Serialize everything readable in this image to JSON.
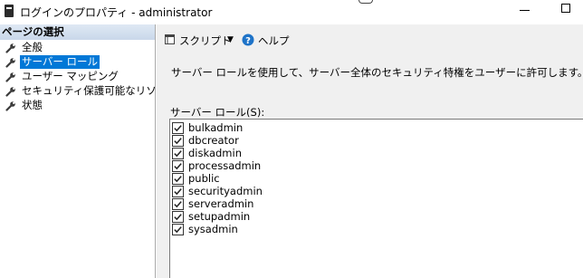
{
  "window": {
    "title": "ログインのプロパティ - administrator"
  },
  "left_pane": {
    "header": "ページの選択",
    "items": [
      {
        "label": "全般",
        "selected": false
      },
      {
        "label": "サーバー ロール",
        "selected": true
      },
      {
        "label": "ユーザー マッピング",
        "selected": false
      },
      {
        "label": "セキュリティ保護可能なリソース",
        "selected": false
      },
      {
        "label": "状態",
        "selected": false
      }
    ]
  },
  "toolbar": {
    "script_label": "スクリプト",
    "help_label": "ヘルプ"
  },
  "main": {
    "description": "サーバー ロールを使用して、サーバー全体のセキュリティ特権をユーザーに許可します。",
    "roles_label": "サーバー ロール(S):",
    "roles": [
      {
        "name": "bulkadmin",
        "checked": true
      },
      {
        "name": "dbcreator",
        "checked": true
      },
      {
        "name": "diskadmin",
        "checked": true
      },
      {
        "name": "processadmin",
        "checked": true
      },
      {
        "name": "public",
        "checked": true
      },
      {
        "name": "securityadmin",
        "checked": true
      },
      {
        "name": "serveradmin",
        "checked": true
      },
      {
        "name": "setupadmin",
        "checked": true
      },
      {
        "name": "sysadmin",
        "checked": true
      }
    ]
  },
  "colors": {
    "selection": "#0078d7",
    "header_bg": "#d4e0ef",
    "pane_bg": "#f0f0f0",
    "help_icon": "#1e73c8"
  }
}
